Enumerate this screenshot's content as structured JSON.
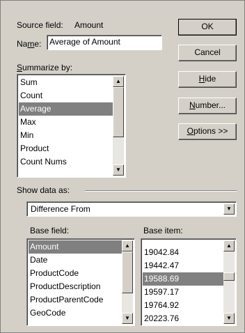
{
  "source_field": {
    "label": "Source field:",
    "value": "Amount"
  },
  "name": {
    "label_pre": "Na",
    "label_accel": "m",
    "label_post": "e:",
    "value": "Average of Amount"
  },
  "summarize": {
    "label_accel": "S",
    "label_rest": "ummarize by:",
    "items": [
      "Sum",
      "Count",
      "Average",
      "Max",
      "Min",
      "Product",
      "Count Nums"
    ],
    "selected": "Average"
  },
  "buttons": {
    "ok": "OK",
    "cancel": "Cancel",
    "hide_accel": "H",
    "hide_rest": "ide",
    "number_accel": "N",
    "number_rest": "umber...",
    "options_accel": "O",
    "options_rest": "ptions >>"
  },
  "show_data_as": {
    "label": "Show data as:",
    "value": "Difference From"
  },
  "base_field": {
    "label": "Base field:",
    "items": [
      "Amount",
      "Date",
      "ProductCode",
      "ProductDescription",
      "ProductParentCode",
      "GeoCode"
    ],
    "selected": "Amount"
  },
  "base_item": {
    "label": "Base item:",
    "items": [
      "19042.84",
      "19442.47",
      "19588.69",
      "19597.17",
      "19764.92",
      "20223.76"
    ],
    "selected": "19588.69"
  },
  "icons": {
    "scroll_up": "up-arrow-icon",
    "scroll_down": "down-arrow-icon",
    "dropdown": "down-arrow-icon"
  },
  "colors": {
    "dialog_bg": "#d4d0c8",
    "selection": "#808080"
  }
}
